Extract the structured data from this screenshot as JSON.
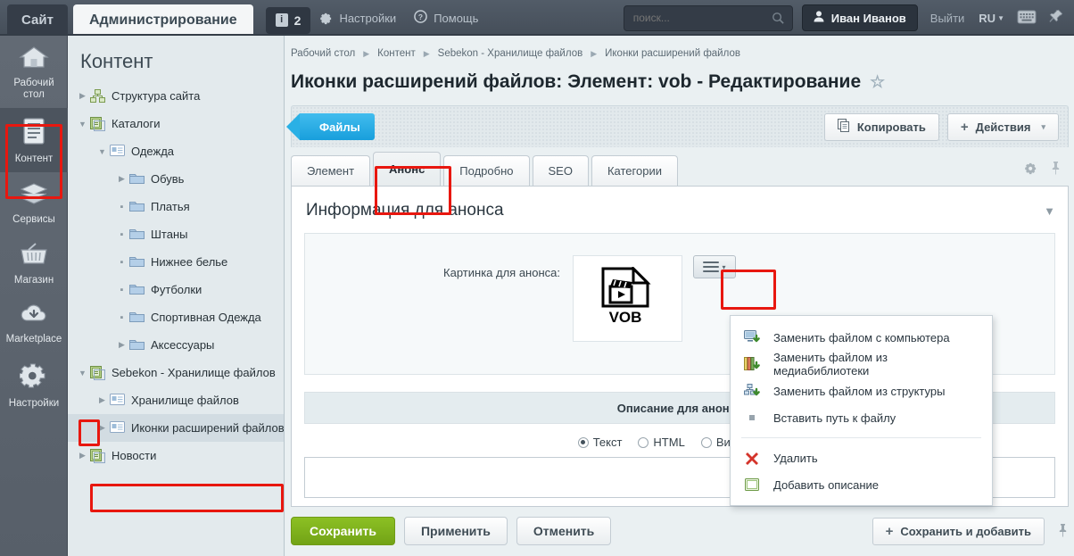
{
  "topbar": {
    "site_tab": "Сайт",
    "admin_tab": "Администрирование",
    "badge_count": "2",
    "badge_icon": "info-icon",
    "settings_label": "Настройки",
    "settings_icon": "gear-icon",
    "help_label": "Помощь",
    "help_icon": "question-icon",
    "search_placeholder": "поиск...",
    "search_value": "",
    "search_icon": "search-icon",
    "user_name": "Иван Иванов",
    "user_icon": "user-icon",
    "logout_label": "Выйти",
    "lang_label": "RU",
    "keyboard_icon": "keyboard-icon",
    "pin_icon": "pin-icon"
  },
  "rail": {
    "items": [
      {
        "label": "Рабочий стол",
        "icon": "home-icon",
        "active": false
      },
      {
        "label": "Контент",
        "icon": "document-icon",
        "active": true
      },
      {
        "label": "Сервисы",
        "icon": "layers-icon",
        "active": false
      },
      {
        "label": "Магазин",
        "icon": "basket-icon",
        "active": false
      },
      {
        "label": "Marketplace",
        "icon": "cloud-download-icon",
        "active": false
      },
      {
        "label": "Настройки",
        "icon": "gear-icon",
        "active": false
      }
    ]
  },
  "tree": {
    "title": "Контент",
    "nodes": [
      {
        "label": "Структура сайта",
        "indent": 0,
        "toggle": "collapsed",
        "icon": "sitemap-icon"
      },
      {
        "label": "Каталоги",
        "indent": 0,
        "toggle": "expanded",
        "icon": "iblock-icon"
      },
      {
        "label": "Одежда",
        "indent": 1,
        "toggle": "expanded",
        "icon": "section-icon"
      },
      {
        "label": "Обувь",
        "indent": 2,
        "toggle": "collapsed",
        "icon": "folder-icon"
      },
      {
        "label": "Платья",
        "indent": 2,
        "toggle": "leaf",
        "icon": "folder-icon"
      },
      {
        "label": "Штаны",
        "indent": 2,
        "toggle": "leaf",
        "icon": "folder-icon"
      },
      {
        "label": "Нижнее белье",
        "indent": 2,
        "toggle": "leaf",
        "icon": "folder-icon"
      },
      {
        "label": "Футболки",
        "indent": 2,
        "toggle": "leaf",
        "icon": "folder-icon"
      },
      {
        "label": "Спортивная Одежда",
        "indent": 2,
        "toggle": "leaf",
        "icon": "folder-icon"
      },
      {
        "label": "Аксессуары",
        "indent": 2,
        "toggle": "collapsed",
        "icon": "folder-icon"
      },
      {
        "label": "Sebekon - Хранилище файлов",
        "indent": 0,
        "toggle": "expanded",
        "icon": "iblock-icon"
      },
      {
        "label": "Хранилище файлов",
        "indent": 1,
        "toggle": "collapsed",
        "icon": "section-icon"
      },
      {
        "label": "Иконки расширений файлов",
        "indent": 1,
        "toggle": "collapsed",
        "icon": "section-icon",
        "selected": true
      },
      {
        "label": "Новости",
        "indent": 0,
        "toggle": "collapsed",
        "icon": "iblock-icon"
      }
    ]
  },
  "breadcrumbs": [
    "Рабочий стол",
    "Контент",
    "Sebekon - Хранилище файлов",
    "Иконки расширений файлов"
  ],
  "page": {
    "title": "Иконки расширений файлов: Элемент: vob - Редактирование",
    "star_icon": "star-icon"
  },
  "toolbar": {
    "ribbon_label": "Файлы",
    "copy_label": "Копировать",
    "copy_icon": "copy-icon",
    "actions_label": "Действия",
    "actions_plus": "+",
    "actions_caret": "▾"
  },
  "tabs": {
    "items": [
      {
        "label": "Элемент",
        "selected": false
      },
      {
        "label": "Анонс",
        "selected": true
      },
      {
        "label": "Подробно",
        "selected": false
      },
      {
        "label": "SEO",
        "selected": false
      },
      {
        "label": "Категории",
        "selected": false
      }
    ],
    "gear_icon": "gear-icon",
    "pin_icon": "pin-icon"
  },
  "panel": {
    "heading": "Информация для анонса",
    "collapse_icon": "chevron-down-icon",
    "image_label": "Картинка для анонса:",
    "file_type": "VOB",
    "file_icon": "video-file-icon",
    "menu_button_icon": "hamburger-menu-icon",
    "menu_button_caret": "▾",
    "description_heading": "Описание для анонса",
    "radios": [
      {
        "label": "Текст",
        "checked": true
      },
      {
        "label": "HTML",
        "checked": false
      },
      {
        "label": "Визуальный",
        "checked": false
      }
    ],
    "textarea_value": ""
  },
  "dropdown": {
    "items": [
      {
        "label": "Заменить файлом с компьютера",
        "icon": "computer-download-icon"
      },
      {
        "label": "Заменить файлом из медиабиблиотеки",
        "icon": "medialibrary-icon"
      },
      {
        "label": "Заменить файлом из структуры",
        "icon": "structure-icon"
      },
      {
        "label": "Вставить путь к файлу",
        "icon": "bullet-icon"
      },
      {
        "separator": true
      },
      {
        "label": "Удалить",
        "icon": "delete-icon"
      },
      {
        "label": "Добавить описание",
        "icon": "description-icon"
      }
    ]
  },
  "footer": {
    "save_label": "Сохранить",
    "apply_label": "Применить",
    "cancel_label": "Отменить",
    "save_add_label": "Сохранить и добавить",
    "save_add_plus": "+",
    "pin_icon": "pin-icon"
  },
  "colors": {
    "accent_blue": "#2aa8e0",
    "save_green": "#8cc024",
    "highlight_red": "#e8170f",
    "topbar_dark": "#4b5563"
  }
}
